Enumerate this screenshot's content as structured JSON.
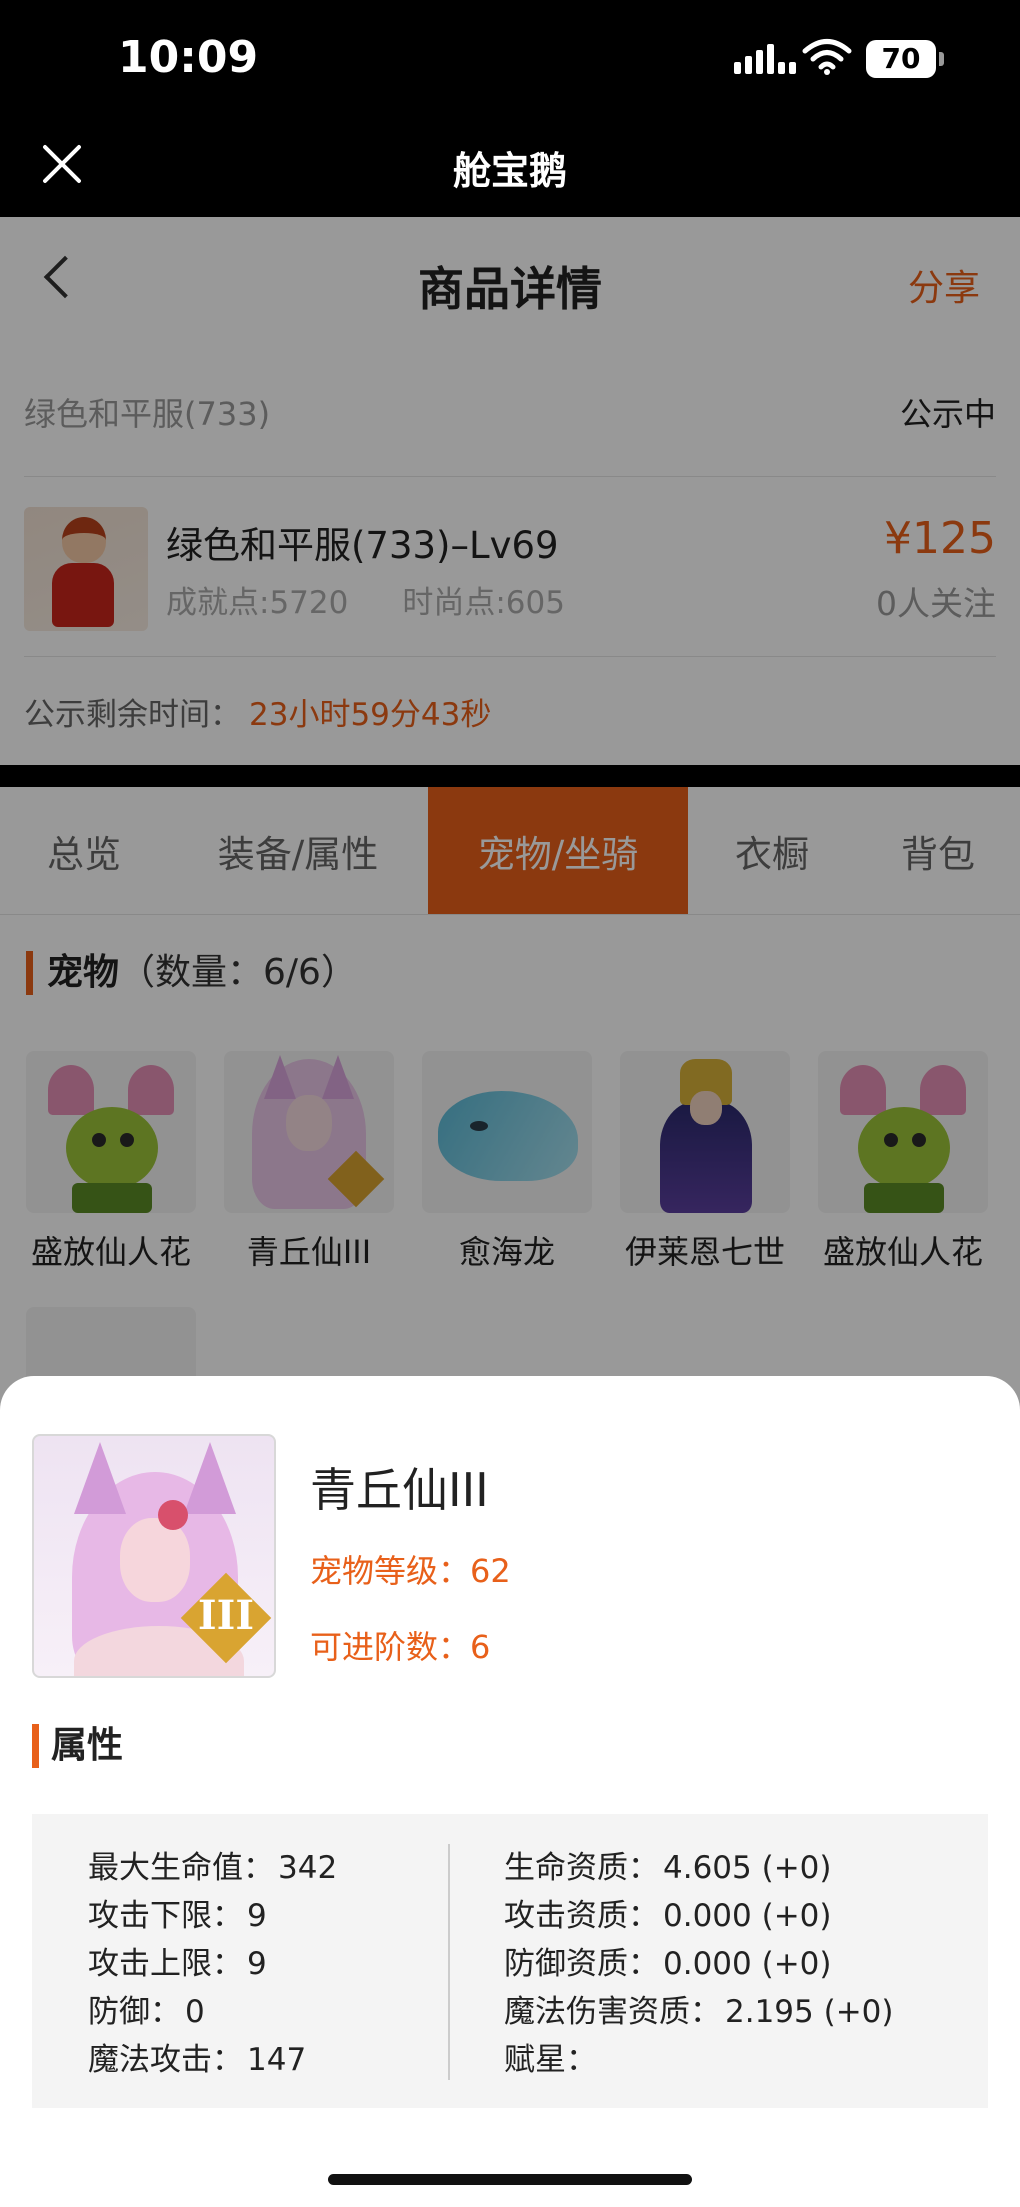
{
  "status_bar": {
    "time": "10:09",
    "battery": "70"
  },
  "app": {
    "title": "舱宝鹅"
  },
  "nav": {
    "title": "商品详情",
    "share": "分享"
  },
  "product": {
    "short_name": "绿色和平服(733)",
    "status": "公示中",
    "full_name": "绿色和平服(733)–Lv69",
    "achievement": "成就点:5720",
    "fashion": "时尚点:605",
    "price": "¥125",
    "watchers": "0人关注",
    "countdown_label": "公示剩余时间：",
    "countdown_value": "23小时59分43秒"
  },
  "tabs": [
    {
      "label": "总览"
    },
    {
      "label": "装备/属性"
    },
    {
      "label": "宠物/坐骑",
      "active": true
    },
    {
      "label": "衣橱"
    },
    {
      "label": "背包"
    }
  ],
  "pets_section": {
    "title": "宠物",
    "count": "（数量：6/6）",
    "pets": [
      {
        "name": "盛放仙人花",
        "icon": "cactus-flower-icon"
      },
      {
        "name": "青丘仙III",
        "icon": "fox-fairy-icon"
      },
      {
        "name": "愈海龙",
        "icon": "sea-dragon-icon"
      },
      {
        "name": "伊莱恩七世",
        "icon": "crowned-hero-icon"
      },
      {
        "name": "盛放仙人花",
        "icon": "cactus-flower-icon"
      }
    ]
  },
  "sheet": {
    "pet_name": "青丘仙III",
    "badge": "III",
    "level": "宠物等级：62",
    "advance": "可进阶数：6",
    "attr_title": "属性",
    "left": [
      {
        "label": "最大生命值：",
        "value": "342"
      },
      {
        "label": "攻击下限：",
        "value": "9"
      },
      {
        "label": "攻击上限：",
        "value": "9"
      },
      {
        "label": "防御：",
        "value": "0"
      },
      {
        "label": "魔法攻击：",
        "value": "147"
      }
    ],
    "right": [
      {
        "label": "生命资质：",
        "value": "4.605 (+0)"
      },
      {
        "label": "攻击资质：",
        "value": "0.000 (+0)"
      },
      {
        "label": "防御资质：",
        "value": "0.000 (+0)"
      },
      {
        "label": "魔法伤害资质：",
        "value": "2.195 (+0)"
      },
      {
        "label": "赋星：",
        "value": ""
      }
    ]
  },
  "colors": {
    "accent": "#e8601a"
  }
}
